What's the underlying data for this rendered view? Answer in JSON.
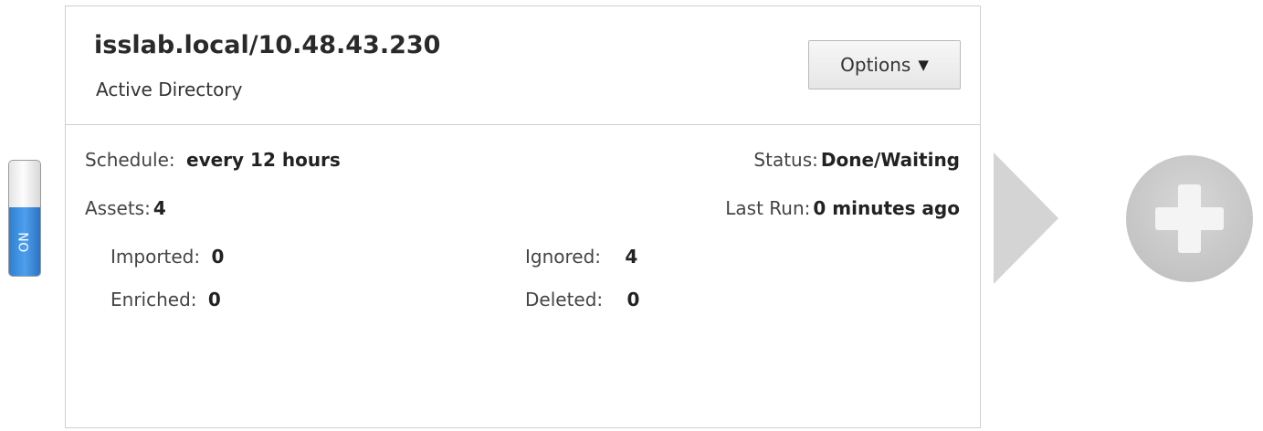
{
  "toggle": {
    "label": "ON",
    "state": "on",
    "on_color": "#3d8de0"
  },
  "card": {
    "title": "isslab.local/10.48.43.230",
    "subtitle": "Active Directory",
    "options_label": "Options",
    "caret_glyph": "▼"
  },
  "details": {
    "schedule_label": "Schedule:",
    "schedule_value": "every 12 hours",
    "status_label": "Status:",
    "status_value": "Done/Waiting",
    "assets_label": "Assets:",
    "assets_value": "4",
    "last_run_label": "Last Run:",
    "last_run_value": "0 minutes ago",
    "imported_label": "Imported:",
    "imported_value": "0",
    "ignored_label": "Ignored:",
    "ignored_value": "4",
    "enriched_label": "Enriched:",
    "enriched_value": "0",
    "deleted_label": "Deleted:",
    "deleted_value": "0"
  },
  "icons": {
    "arrow": "play-arrow-icon",
    "add": "plus-circle-icon"
  }
}
